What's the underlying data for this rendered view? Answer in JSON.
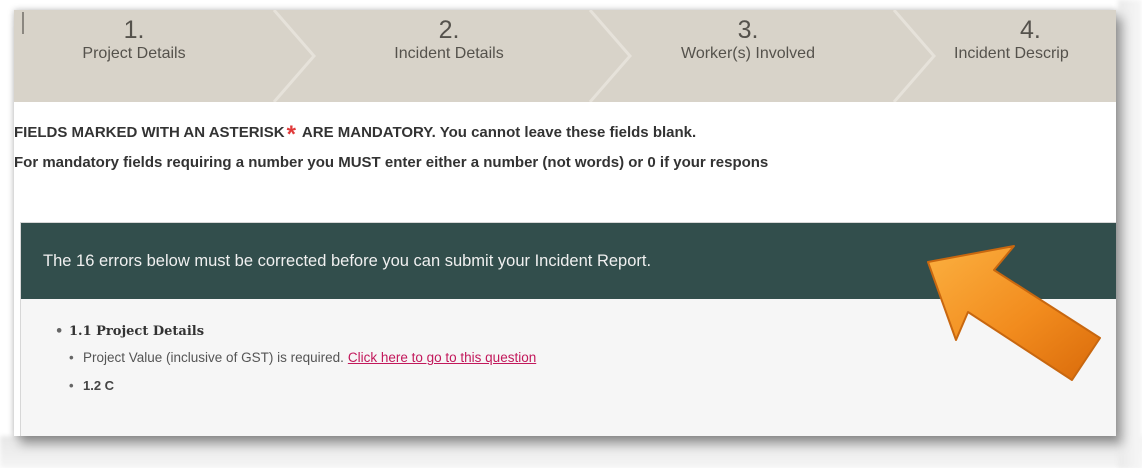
{
  "steps": [
    {
      "num": "1.",
      "label": "Project Details"
    },
    {
      "num": "2.",
      "label": "Incident Details"
    },
    {
      "num": "3.",
      "label": "Worker(s) Involved"
    },
    {
      "num": "4.",
      "label": "Incident Descrip"
    }
  ],
  "instructions": {
    "mandatory_prefix": "FIELDS MARKED WITH AN ASTERISK",
    "asterisk": "*",
    "mandatory_suffix": "ARE MANDATORY. You cannot leave these fields blank.",
    "number_rule": "For mandatory fields requiring a number you MUST enter either a number (not words) or 0 if your respons"
  },
  "errors": {
    "banner": "The 16 errors below must be corrected before you can submit your Incident Report.",
    "sections": [
      {
        "title": "1.1 Project Details",
        "items": [
          {
            "text": "Project Value (inclusive of GST) is required.",
            "link": "Click here to go to this question"
          }
        ]
      }
    ],
    "cut_off_text": "1.2 C"
  },
  "colors": {
    "step_bar": "#d8d3c9",
    "error_banner": "#324e4c",
    "asterisk": "#e03a3a",
    "link": "#c2185b",
    "arrow": "#f28c1e"
  },
  "icons": {
    "annotation": "orange-arrow-icon",
    "bullet": "bullet-icon"
  }
}
